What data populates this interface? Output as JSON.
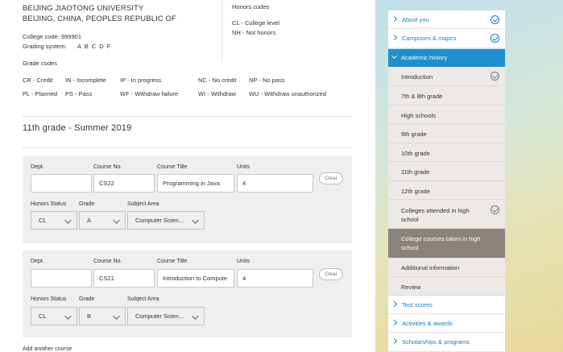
{
  "header": {
    "university": "BEIJING JIAOTONG UNIVERSITY",
    "location": "BEIJING, CHINA, PEOPLES REPUBLIC OF",
    "college_code_label": "College code:",
    "college_code": "999901",
    "grading_label": "Grading system:",
    "grading_value": "A B C D F",
    "honors_title": "Honors codes",
    "honors": [
      "CL - College level",
      "NH - Not honors"
    ]
  },
  "grade_codes": {
    "title": "Grade codes",
    "row1": [
      "CR - Credit",
      "IN - Incomplete",
      "IP - In progress",
      "NC - No credit",
      "NP - No pass"
    ],
    "row2": [
      "PL - Planned",
      "PS - Pass",
      "WF - Withdraw failure",
      "WI - Withdraw",
      "WU - Withdraw unauthorized"
    ]
  },
  "section": {
    "title": "11th grade - Summer 2019"
  },
  "labels": {
    "dept": "Dept.",
    "course_no": "Course No.",
    "course_title": "Course Title",
    "units": "Units",
    "honors_status": "Honors Status",
    "grade": "Grade",
    "subject_area": "Subject Area",
    "clear": "Clear"
  },
  "courses": [
    {
      "dept": "",
      "course_no": "CS22",
      "course_title": "Programming in Java",
      "units": "4",
      "honors_status": "CL",
      "grade": "A",
      "subject_area": "Computer Scien..."
    },
    {
      "dept": "",
      "course_no": "CS21",
      "course_title": "Introduction to Compute",
      "units": "4",
      "honors_status": "CL",
      "grade": "B",
      "subject_area": "Computer Scien..."
    }
  ],
  "add_course": "Add another course",
  "sidebar": {
    "top": [
      {
        "label": "About you"
      },
      {
        "label": "Campuses & majors"
      }
    ],
    "active_section": "Academic history",
    "sub": [
      {
        "label": "Introduction"
      },
      {
        "label": "7th & 8th grade"
      },
      {
        "label": "High schools"
      },
      {
        "label": "9th grade"
      },
      {
        "label": "10th grade"
      },
      {
        "label": "11th grade"
      },
      {
        "label": "12th grade"
      },
      {
        "label": "Colleges attended in high school"
      },
      {
        "label": "College courses taken in high school"
      },
      {
        "label": "Additional information"
      },
      {
        "label": "Review"
      }
    ],
    "bottom": [
      {
        "label": "Test scores"
      },
      {
        "label": "Activities & awards"
      },
      {
        "label": "Scholarships & programs"
      }
    ]
  },
  "colors": {
    "accent": "#1e8ecf",
    "link": "#1a7fc1",
    "current": "#8b827c",
    "sub_bg": "#ece9e7"
  }
}
